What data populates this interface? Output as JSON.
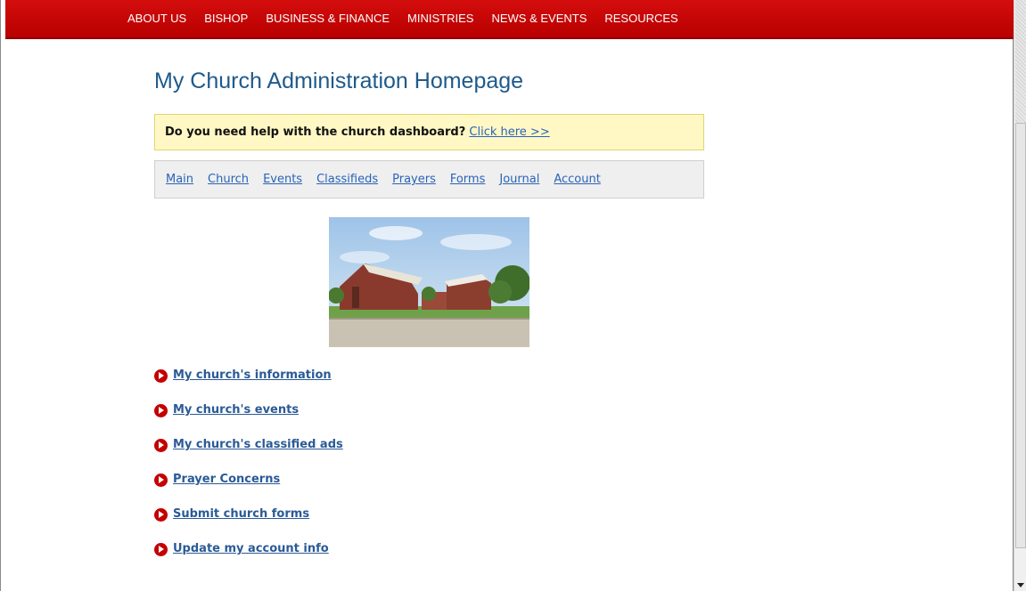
{
  "top_nav": {
    "items": [
      "ABOUT US",
      "BISHOP",
      "BUSINESS & FINANCE",
      "MINISTRIES",
      "NEWS & EVENTS",
      "RESOURCES"
    ]
  },
  "page": {
    "title": "My Church Administration Homepage"
  },
  "help_box": {
    "question": "Do you need help with the church dashboard?",
    "link": "Click here >>",
    "background": "#fff8c4"
  },
  "sub_nav": {
    "items": [
      "Main",
      "Church",
      "Events",
      "Classifieds",
      "Prayers",
      "Forms",
      "Journal",
      "Account"
    ]
  },
  "links": [
    "My church's information",
    "My church's events",
    "My church's classified ads",
    "Prayer Concerns",
    "Submit church forms",
    "Update my account info"
  ],
  "colors": {
    "nav_red": "#c40000",
    "title_blue": "#1e5a8c",
    "link_blue": "#2a63b8"
  },
  "icons": {
    "bullet": "arrow-circle-right-icon",
    "scroll_down": "scroll-down-arrow-icon"
  }
}
